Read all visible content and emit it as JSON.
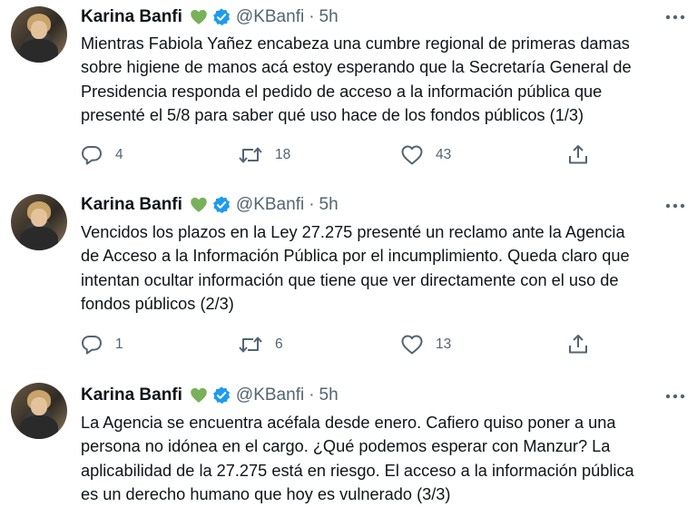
{
  "tweets": [
    {
      "author_name": "Karina Banfi",
      "emoji": "green-heart",
      "verified": true,
      "handle": "@KBanfi",
      "separator": "·",
      "time": "5h",
      "lines": [
        "Mientras Fabiola Yañez encabeza una cumbre regional de primeras damas",
        "sobre higiene de manos acá estoy esperando que la Secretaría General de",
        "Presidencia responda el pedido de acceso a la información pública que",
        "presenté el 5/8 para saber qué uso hace de los fondos públicos (1/3)"
      ],
      "replies": "4",
      "retweets": "18",
      "likes": "43"
    },
    {
      "author_name": "Karina Banfi",
      "emoji": "green-heart",
      "verified": true,
      "handle": "@KBanfi",
      "separator": "·",
      "time": "5h",
      "lines": [
        "Vencidos los plazos en la Ley 27.275 presenté un reclamo ante la Agencia",
        "de Acceso a la Información Pública por el incumplimiento. Queda claro que",
        "intentan ocultar información que tiene que ver directamente con el uso de",
        "fondos públicos (2/3)"
      ],
      "replies": "1",
      "retweets": "6",
      "likes": "13"
    },
    {
      "author_name": "Karina Banfi",
      "emoji": "green-heart",
      "verified": true,
      "handle": "@KBanfi",
      "separator": "·",
      "time": "5h",
      "lines": [
        "La Agencia se encuentra acéfala desde enero. Cafiero quiso poner a una",
        "persona no idónea en el cargo. ¿Qué podemos esperar con Manzur? La",
        "aplicabilidad de la 27.275 está en riesgo. El acceso a la información pública",
        "es un derecho humano que hoy es vulnerado (3/3)"
      ]
    }
  ],
  "colors": {
    "text": "#0f1419",
    "secondary": "#536471",
    "verified": "#1d9bf0",
    "heart": "#78b159"
  },
  "icons": [
    "reply-icon",
    "retweet-icon",
    "like-icon",
    "share-icon",
    "more-icon",
    "verified-badge-icon",
    "green-heart-icon"
  ]
}
